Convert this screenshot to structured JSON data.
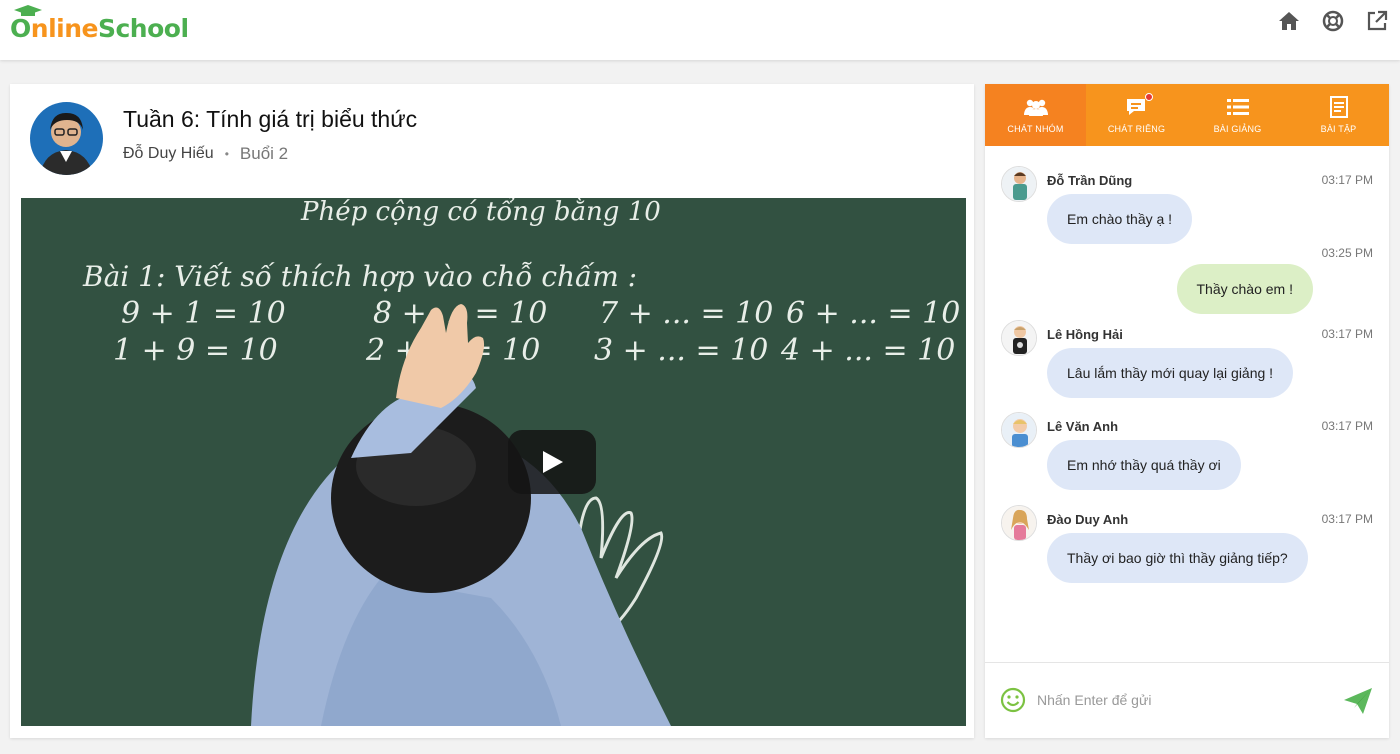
{
  "header": {
    "logo_first": "O",
    "logo_middle": "nline",
    "logo_last": "School",
    "icons": [
      "home-icon",
      "lifebuoy-icon",
      "share-icon"
    ]
  },
  "lesson": {
    "title": "Tuần 6: Tính giá trị biểu thức",
    "teacher": "Đỗ Duy Hiếu",
    "separator": "•",
    "session": "Buổi 2"
  },
  "video": {
    "board_heading": "Phép cộng có tổng bằng 10",
    "board_exercise": "Bài 1: Viết số thích hợp vào chỗ chấm :",
    "row1": [
      "9 + 1 = 10",
      "8 + ... = 10",
      "7 + ... = 10",
      "6 + ... = 10"
    ],
    "row2": [
      "1 + 9 = 10",
      "2 + ... = 10",
      "3 + ... = 10",
      "4 + ... = 10"
    ]
  },
  "chat": {
    "tabs": [
      {
        "label": "CHÁT NHÓM",
        "icon": "group-icon",
        "active": true
      },
      {
        "label": "CHÁT RIÊNG",
        "icon": "private-chat-icon",
        "active": false
      },
      {
        "label": "BÀI GIẢNG",
        "icon": "list-icon",
        "active": false
      },
      {
        "label": "BÀI TẬP",
        "icon": "document-icon",
        "active": false
      }
    ],
    "messages": [
      {
        "name": "Đỗ Trần Dũng",
        "time": "03:17 PM",
        "text": "Em chào thầy ạ !"
      },
      {
        "name": "",
        "time": "03:25 PM",
        "text": "Thầy chào em !"
      },
      {
        "name": "Lê Hồng Hải",
        "time": "03:17 PM",
        "text": "Lâu lắm thầy mới quay lại giảng !"
      },
      {
        "name": "Lê Văn Anh",
        "time": "03:17 PM",
        "text": "Em nhớ thầy quá thầy ơi"
      },
      {
        "name": "Đào Duy Anh",
        "time": "03:17 PM",
        "text": "Thầy ơi bao giờ thì thầy giảng tiếp?"
      }
    ],
    "input_placeholder": "Nhấn Enter để gửi"
  },
  "colors": {
    "brand_orange": "#f7941d",
    "brand_green": "#4caf50",
    "bubble_other": "#dee7f7",
    "bubble_mine": "#dcefc6"
  }
}
